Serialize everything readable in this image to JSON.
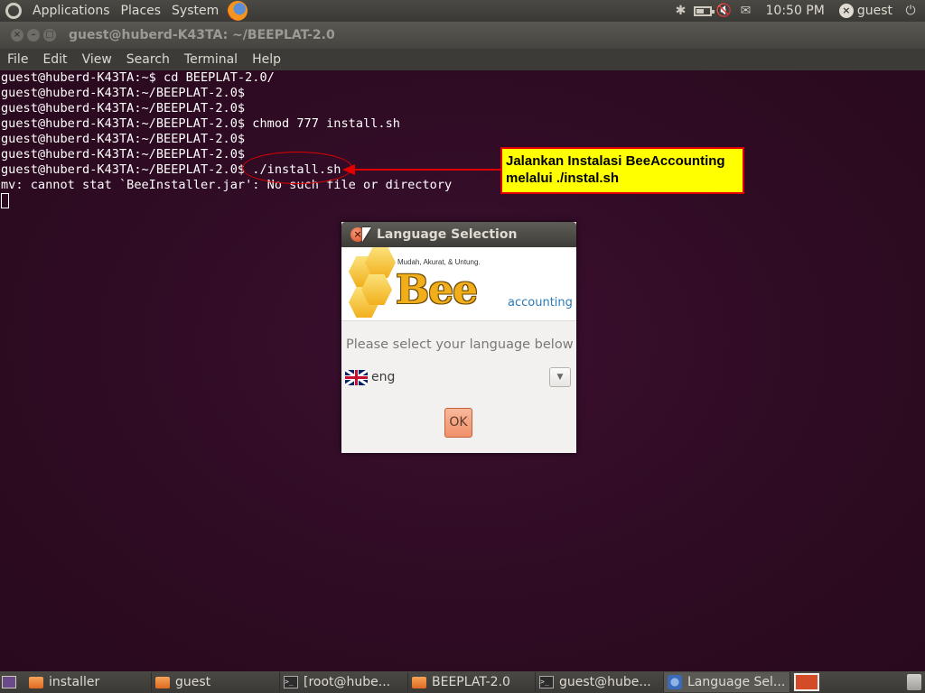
{
  "top_panel": {
    "menus": [
      "Applications",
      "Places",
      "System"
    ],
    "clock": "10:50 PM",
    "user": "guest",
    "battery_fraction": 0.55
  },
  "terminal": {
    "title": "guest@huberd-K43TA: ~/BEEPLAT-2.0",
    "menu": [
      "File",
      "Edit",
      "View",
      "Search",
      "Terminal",
      "Help"
    ],
    "lines": [
      "guest@huberd-K43TA:~$ cd BEEPLAT-2.0/",
      "guest@huberd-K43TA:~/BEEPLAT-2.0$",
      "guest@huberd-K43TA:~/BEEPLAT-2.0$",
      "guest@huberd-K43TA:~/BEEPLAT-2.0$ chmod 777 install.sh",
      "guest@huberd-K43TA:~/BEEPLAT-2.0$",
      "guest@huberd-K43TA:~/BEEPLAT-2.0$",
      "guest@huberd-K43TA:~/BEEPLAT-2.0$ ./install.sh",
      "mv: cannot stat `BeeInstaller.jar': No such file or directory"
    ]
  },
  "annotation": {
    "line1": "Jalankan Instalasi BeeAccounting",
    "line2": "melalui ./instal.sh"
  },
  "dialog": {
    "title": "Language Selection",
    "logo_tagline": "Mudah, Akurat, & Untung.",
    "logo_word": "Bee",
    "logo_sub": "accounting",
    "prompt": "Please select your language below",
    "selected_language": "eng",
    "ok_label": "OK"
  },
  "taskbar": {
    "tasks": [
      "installer",
      "guest",
      "[root@hube...",
      "BEEPLAT-2.0",
      "guest@hube...",
      "Language Sel..."
    ]
  },
  "colors": {
    "terminal_bg": "#2c0a1e",
    "annotation_fill": "#ffff00",
    "annotation_border": "#e00000",
    "ok_button": "#f0906a"
  }
}
